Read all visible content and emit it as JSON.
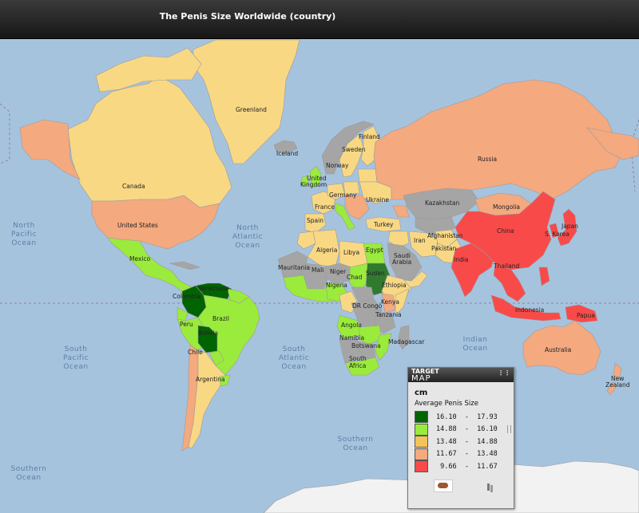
{
  "title": "The Penis Size Worldwide (country)",
  "colors": {
    "ocean": "#a6c3de",
    "none": "#a5a5a5",
    "c1": "#006400",
    "c2": "#9aeb3c",
    "c3": "#f4c25a",
    "c4": "#f4a97f",
    "c5": "#f94a4a"
  },
  "oceans": {
    "north_pacific": [
      "North",
      "Pacific",
      "Ocean"
    ],
    "north_atlantic": [
      "North",
      "Atlantic",
      "Ocean"
    ],
    "south_pacific": [
      "South",
      "Pacific",
      "Ocean"
    ],
    "south_atlantic": [
      "South",
      "Atlantic",
      "Ocean"
    ],
    "indian": [
      "Indian",
      "Ocean"
    ],
    "southern_mid": [
      "Southern",
      "Ocean"
    ],
    "southern_left": [
      "Southern",
      "Ocean"
    ]
  },
  "countries": {
    "greenland": "Greenland",
    "iceland": "Iceland",
    "canada": "Canada",
    "united_states": "United States",
    "mexico": "Mexico",
    "venezuela": "Venezuela",
    "colombia": "Colombia",
    "peru": "Peru",
    "brazil": "Brazil",
    "bolivia": "Bolivia",
    "chile": "Chile",
    "argentina": "Argentina",
    "finland": "Finland",
    "sweden": "Sweden",
    "norway": "Norway",
    "uk_1": "United",
    "uk_2": "Kingdom",
    "france": "France",
    "germany": "Germany",
    "spain": "Spain",
    "ukraine": "Ukraine",
    "turkey": "Turkey",
    "russia": "Russia",
    "kazakhstan": "Kazakhstan",
    "mongolia": "Mongolia",
    "china": "China",
    "japan": "Japan",
    "south_korea": "S. Korea",
    "afghanistan": "Afghanistan",
    "iran": "Iran",
    "pakistan": "Pakistan",
    "india": "India",
    "thailand": "Thailand",
    "indonesia": "Indonesia",
    "papua": "Papua",
    "saudi_1": "Saudi",
    "saudi_2": "Arabia",
    "egypt": "Egypt",
    "libya": "Libya",
    "algeria": "Algeria",
    "mauritania": "Mauritania",
    "mali": "Mali",
    "niger": "Niger",
    "nigeria": "Nigeria",
    "chad": "Chad",
    "sudan": "Sudan",
    "ethiopia": "Ethiopia",
    "dr_congo": "DR Congo",
    "kenya": "Kenya",
    "tanzania": "Tanzania",
    "angola": "Angola",
    "namibia": "Namibia",
    "botswana": "Botswana",
    "south_africa_1": "South",
    "south_africa_2": "Africa",
    "madagascar": "Madagascar",
    "australia": "Australia",
    "new_zealand_1": "New",
    "new_zealand_2": "Zealand"
  },
  "legend": {
    "brand_top": "TARGET",
    "brand_bottom": "MAP",
    "unit": "cm",
    "title": "Average Penis Size",
    "items": [
      {
        "min": "16.10",
        "max": "17.93",
        "color": "#006400"
      },
      {
        "min": "14.88",
        "max": "16.10",
        "color": "#9aeb3c"
      },
      {
        "min": "13.48",
        "max": "14.88",
        "color": "#f4c25a"
      },
      {
        "min": "11.67",
        "max": "13.48",
        "color": "#f4a97f"
      },
      {
        "min": " 9.66",
        "max": "11.67",
        "color": "#f94a4a"
      }
    ]
  }
}
